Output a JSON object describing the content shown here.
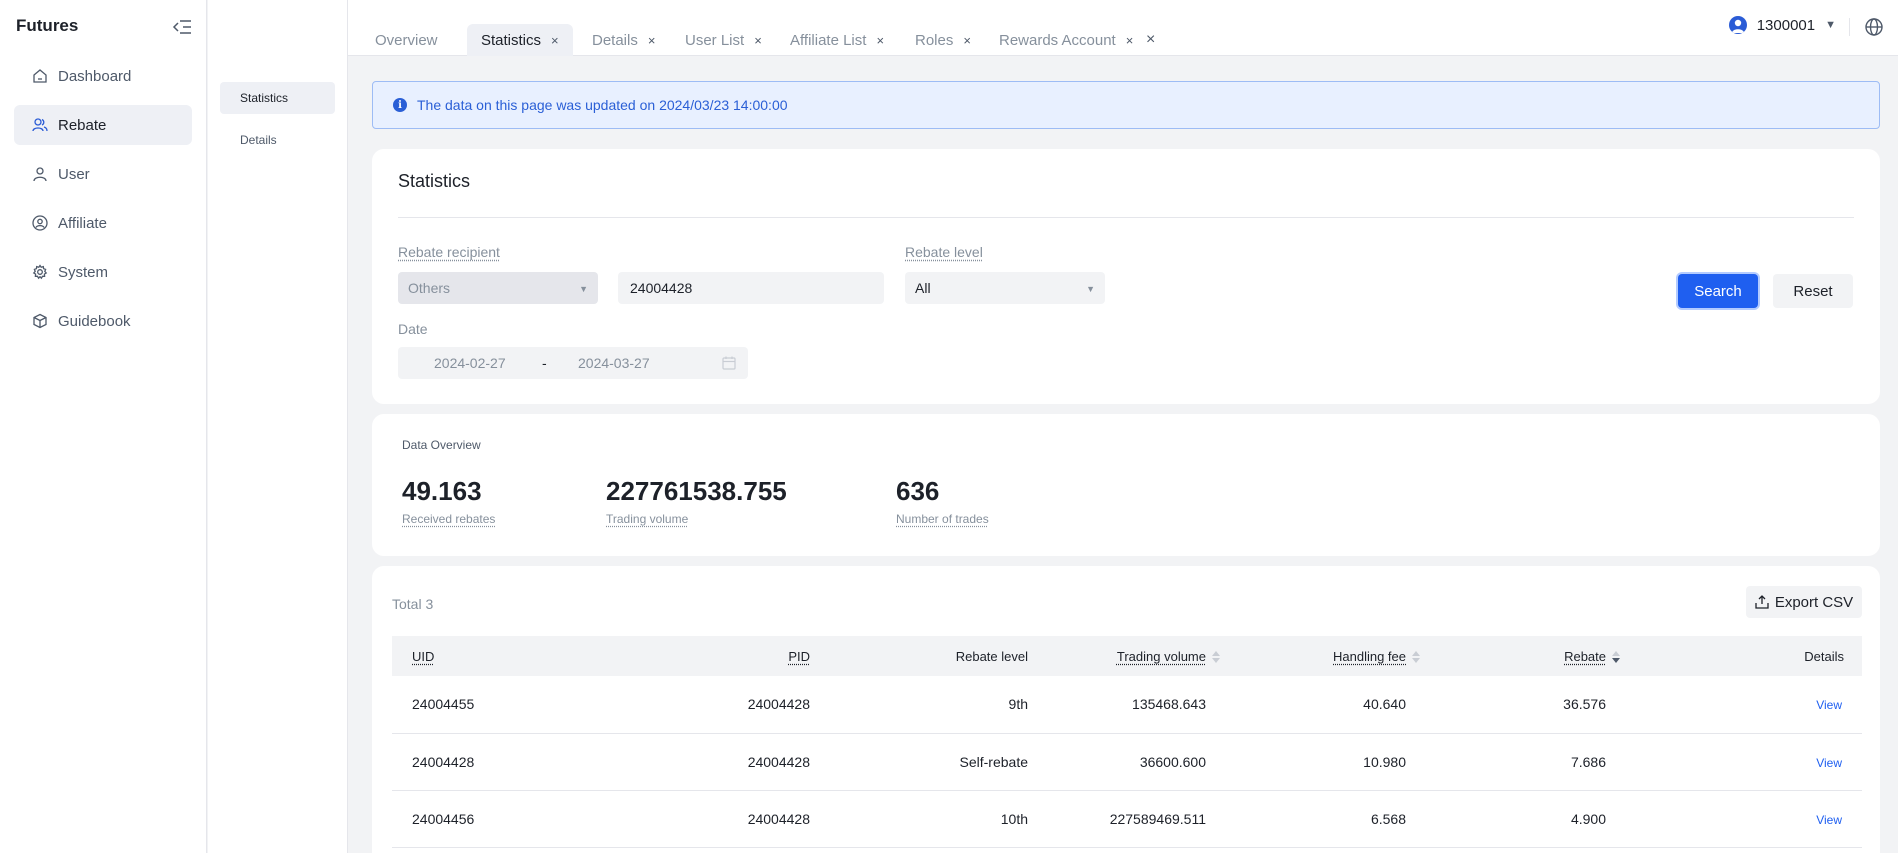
{
  "sidebar": {
    "brand": "Futures",
    "items": [
      {
        "label": "Dashboard",
        "icon": "home-icon"
      },
      {
        "label": "Rebate",
        "icon": "users-icon"
      },
      {
        "label": "User",
        "icon": "user-icon"
      },
      {
        "label": "Affiliate",
        "icon": "affiliate-icon"
      },
      {
        "label": "System",
        "icon": "gear-icon"
      },
      {
        "label": "Guidebook",
        "icon": "cube-icon"
      }
    ]
  },
  "submenu": {
    "items": [
      {
        "label": "Statistics"
      },
      {
        "label": "Details"
      }
    ]
  },
  "tabs": [
    {
      "label": "Overview"
    },
    {
      "label": "Statistics",
      "close": "×"
    },
    {
      "label": "Details",
      "close": "×"
    },
    {
      "label": "User List",
      "close": "×"
    },
    {
      "label": "Affiliate List",
      "close": "×"
    },
    {
      "label": "Roles",
      "close": "×"
    },
    {
      "label": "Rewards Account",
      "close": "×"
    }
  ],
  "tabs_close_all": "×",
  "user": {
    "id": "1300001"
  },
  "alert": {
    "text": "The data on this page was updated on 2024/03/23 14:00:00"
  },
  "filters": {
    "title": "Statistics",
    "recipient_label": "Rebate recipient",
    "recipient_value": "Others",
    "uid_value": "24004428",
    "level_label": "Rebate level",
    "level_value": "All",
    "date_label": "Date",
    "date_from": "2024-02-27",
    "date_sep": "-",
    "date_to": "2024-03-27",
    "search_label": "Search",
    "reset_label": "Reset"
  },
  "overview": {
    "title": "Data Overview",
    "stats": [
      {
        "value": "49.163",
        "label": "Received rebates"
      },
      {
        "value": "227761538.755",
        "label": "Trading volume"
      },
      {
        "value": "636",
        "label": "Number of trades"
      }
    ]
  },
  "table": {
    "total": "Total 3",
    "export_label": "Export CSV",
    "headers": {
      "uid": "UID",
      "pid": "PID",
      "level": "Rebate level",
      "volume": "Trading volume",
      "fee": "Handling fee",
      "rebate": "Rebate",
      "details": "Details"
    },
    "rows": [
      {
        "uid": "24004455",
        "pid": "24004428",
        "level": "9th",
        "volume": "135468.643",
        "fee": "40.640",
        "rebate": "36.576",
        "action": "View"
      },
      {
        "uid": "24004428",
        "pid": "24004428",
        "level": "Self-rebate",
        "volume": "36600.600",
        "fee": "10.980",
        "rebate": "7.686",
        "action": "View"
      },
      {
        "uid": "24004456",
        "pid": "24004428",
        "level": "10th",
        "volume": "227589469.511",
        "fee": "6.568",
        "rebate": "4.900",
        "action": "View"
      }
    ]
  },
  "colors": {
    "accent": "#1f5ff0",
    "alert_bg": "#e8f0ff",
    "alert_text": "#2a5fd6"
  }
}
